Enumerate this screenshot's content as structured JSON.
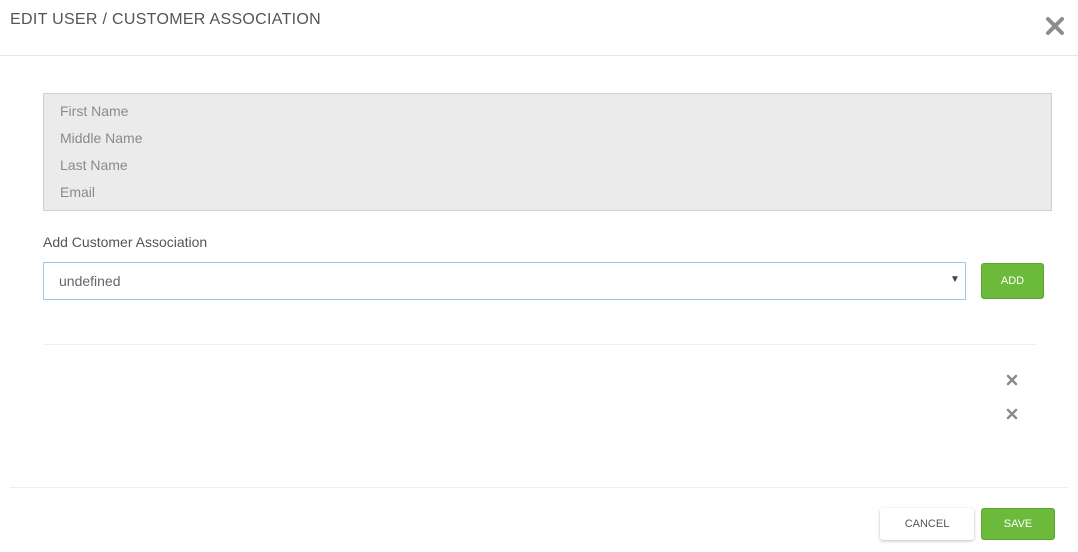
{
  "dialog": {
    "title": "EDIT USER / CUSTOMER ASSOCIATION",
    "close_icon": "close-icon"
  },
  "user_info": {
    "first_name_label": "First Name",
    "middle_name_label": "Middle Name",
    "last_name_label": "Last Name",
    "email_label": "Email"
  },
  "association": {
    "label": "Add Customer Association",
    "select_value": "undefined",
    "add_label": "ADD"
  },
  "rows": [
    {
      "remove_icon": "remove-icon"
    },
    {
      "remove_icon": "remove-icon"
    }
  ],
  "footer": {
    "cancel_label": "CANCEL",
    "save_label": "SAVE"
  },
  "colors": {
    "accent_green": "#6cba3c",
    "select_border": "#9ec8e6",
    "info_box_bg": "#ebebeb"
  }
}
